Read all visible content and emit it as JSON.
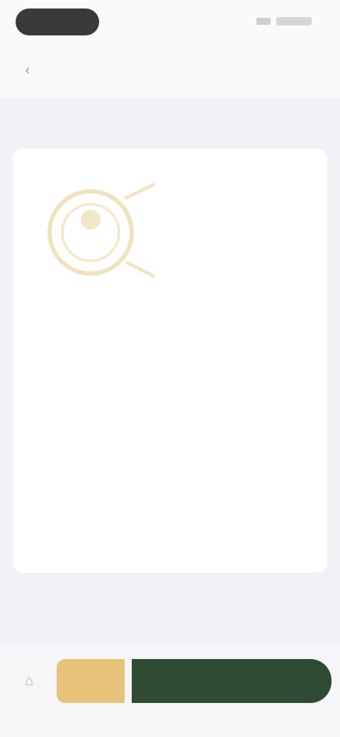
{
  "nav": {
    "back_icon": "chevron-left-icon",
    "title": "",
    "right_label": ""
  },
  "section": {
    "label": ""
  },
  "card": {
    "header_text": "",
    "rows": [
      {
        "key": "",
        "value": ""
      },
      {
        "key": "",
        "value": ""
      },
      {
        "key": "",
        "value": ""
      },
      {
        "key": "",
        "value": ""
      },
      {
        "key": "",
        "value": ""
      }
    ]
  },
  "bottom": {
    "left_icon": "home-icon",
    "gold_button_label": "",
    "green_button_label": ""
  },
  "colors": {
    "gold": "#e8c27a",
    "green": "#2f4a33",
    "background": "#f2f2f6"
  }
}
